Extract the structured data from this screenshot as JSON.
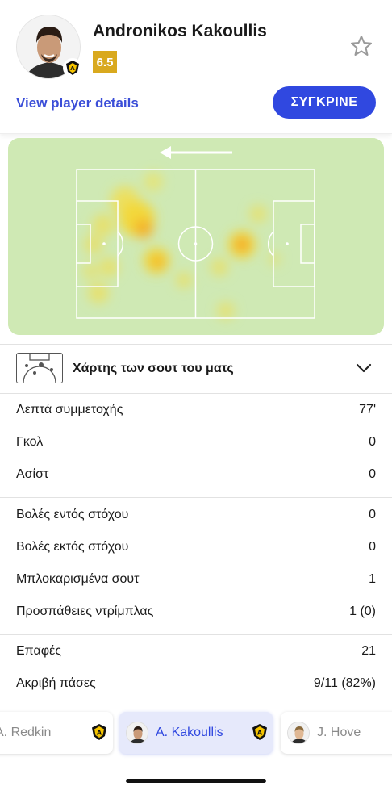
{
  "player": {
    "name": "Andronikos Kakoullis",
    "rating": "6.5",
    "details_link": "View player details",
    "compare_label": "ΣΥΓΚΡΙΝΕ"
  },
  "heatmap": {
    "direction": "left",
    "colors": {
      "pitch": "#cfe9b4",
      "lines": "#ffffff",
      "hot": "#f2c200",
      "warm": "#f6e04a"
    }
  },
  "shotmap": {
    "title": "Χάρτης των σουτ του ματς",
    "icon": "shotmap-pitch-icon",
    "toggle_icon": "chevron-down-icon"
  },
  "stats": [
    {
      "label": "Λεπτά συμμετοχής",
      "value": "77'"
    },
    {
      "label": "Γκολ",
      "value": "0"
    },
    {
      "label": "Ασίστ",
      "value": "0"
    },
    {
      "label": "Βολές εντός στόχου",
      "value": "0"
    },
    {
      "label": "Βολές εκτός στόχου",
      "value": "0"
    },
    {
      "label": "Μπλοκαρισμένα σουτ",
      "value": "1"
    },
    {
      "label": "Προσπάθειες ντρίμπλας",
      "value": "1 (0)"
    },
    {
      "label": "Επαφές",
      "value": "21"
    },
    {
      "label": "Ακριβή πάσες",
      "value": "9/11 (82%)"
    }
  ],
  "tabs": [
    {
      "label": "A. Redkin",
      "active": false
    },
    {
      "label": "A. Kakoullis",
      "active": true
    },
    {
      "label": "J. Hove",
      "active": false
    }
  ],
  "colors": {
    "accent": "#3048e0",
    "link": "#3b4ed8",
    "rating": "#d9a91e",
    "badge_yellow": "#f5c400",
    "badge_black": "#111111"
  }
}
